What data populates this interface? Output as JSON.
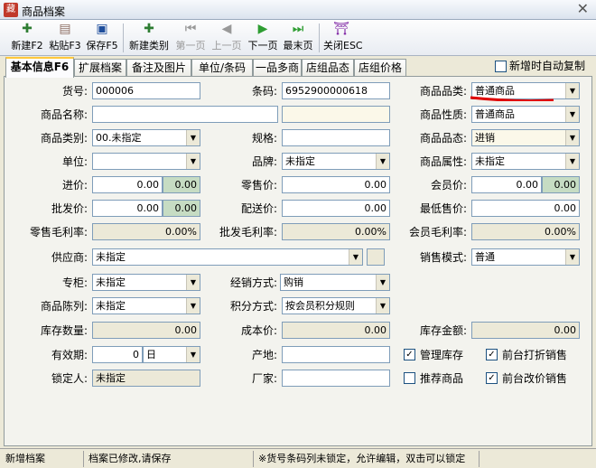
{
  "window": {
    "title": "商品档案",
    "close": "✕",
    "icon": "藏"
  },
  "toolbar": {
    "new": "新建F2",
    "paste": "粘贴F3",
    "save": "保存F5",
    "new_category": "新建类别",
    "first": "第一页",
    "prev": "上一页",
    "next": "下一页",
    "last": "最末页",
    "close": "关闭ESC"
  },
  "tabs": [
    "基本信息F6",
    "扩展档案",
    "备注及图片",
    "单位/条码",
    "一品多商",
    "店组品态",
    "店组价格"
  ],
  "auto_copy": "新增时自动复制",
  "form": {
    "goods_no": {
      "label": "货号:",
      "value": "000006"
    },
    "barcode": {
      "label": "条码:",
      "value": "6952900000618"
    },
    "goods_kind": {
      "label": "商品品类:",
      "value": "普通商品"
    },
    "goods_name": {
      "label": "商品名称:",
      "value": ""
    },
    "goods_nature": {
      "label": "商品性质:",
      "value": "普通商品"
    },
    "goods_category": {
      "label": "商品类别:",
      "value": "00.未指定"
    },
    "spec": {
      "label": "规格:",
      "value": ""
    },
    "goods_status": {
      "label": "商品品态:",
      "value": "进销"
    },
    "unit": {
      "label": "单位:",
      "value": ""
    },
    "brand": {
      "label": "品牌:",
      "value": "未指定"
    },
    "goods_attr": {
      "label": "商品属性:",
      "value": "未指定"
    },
    "purchase_price": {
      "label": "进价:",
      "value": "0.00",
      "extra": "0.00"
    },
    "retail_price": {
      "label": "零售价:",
      "value": "0.00"
    },
    "member_price": {
      "label": "会员价:",
      "value": "0.00",
      "extra": "0.00"
    },
    "wholesale_price": {
      "label": "批发价:",
      "value": "0.00",
      "extra": "0.00"
    },
    "delivery_price": {
      "label": "配送价:",
      "value": "0.00"
    },
    "min_price": {
      "label": "最低售价:",
      "value": "0.00"
    },
    "retail_margin": {
      "label": "零售毛利率:",
      "value": "0.00%"
    },
    "wholesale_margin": {
      "label": "批发毛利率:",
      "value": "0.00%"
    },
    "member_margin": {
      "label": "会员毛利率:",
      "value": "0.00%"
    },
    "supplier": {
      "label": "供应商:",
      "value": "未指定"
    },
    "sales_mode": {
      "label": "销售模式:",
      "value": "普通"
    },
    "counter": {
      "label": "专柜:",
      "value": "未指定"
    },
    "operation_mode": {
      "label": "经销方式:",
      "value": "购销"
    },
    "display": {
      "label": "商品陈列:",
      "value": "未指定"
    },
    "points_mode": {
      "label": "积分方式:",
      "value": "按会员积分规则"
    },
    "stock_qty": {
      "label": "库存数量:",
      "value": "0.00"
    },
    "cost_price": {
      "label": "成本价:",
      "value": "0.00"
    },
    "stock_amount": {
      "label": "库存金额:",
      "value": "0.00"
    },
    "validity": {
      "label": "有效期:",
      "value": "0",
      "unit": "日"
    },
    "origin": {
      "label": "产地:",
      "value": ""
    },
    "locker": {
      "label": "锁定人:",
      "value": "未指定"
    },
    "manufacturer": {
      "label": "厂家:",
      "value": ""
    }
  },
  "checks": {
    "manage_stock": "管理库存",
    "discount_sale": "前台打折销售",
    "recommend": "推荐商品",
    "price_change": "前台改价销售"
  },
  "status": {
    "mode": "新增档案",
    "modified": "档案已修改,请保存",
    "hint": "※货号条码列未锁定，允许编辑，双击可以锁定"
  }
}
